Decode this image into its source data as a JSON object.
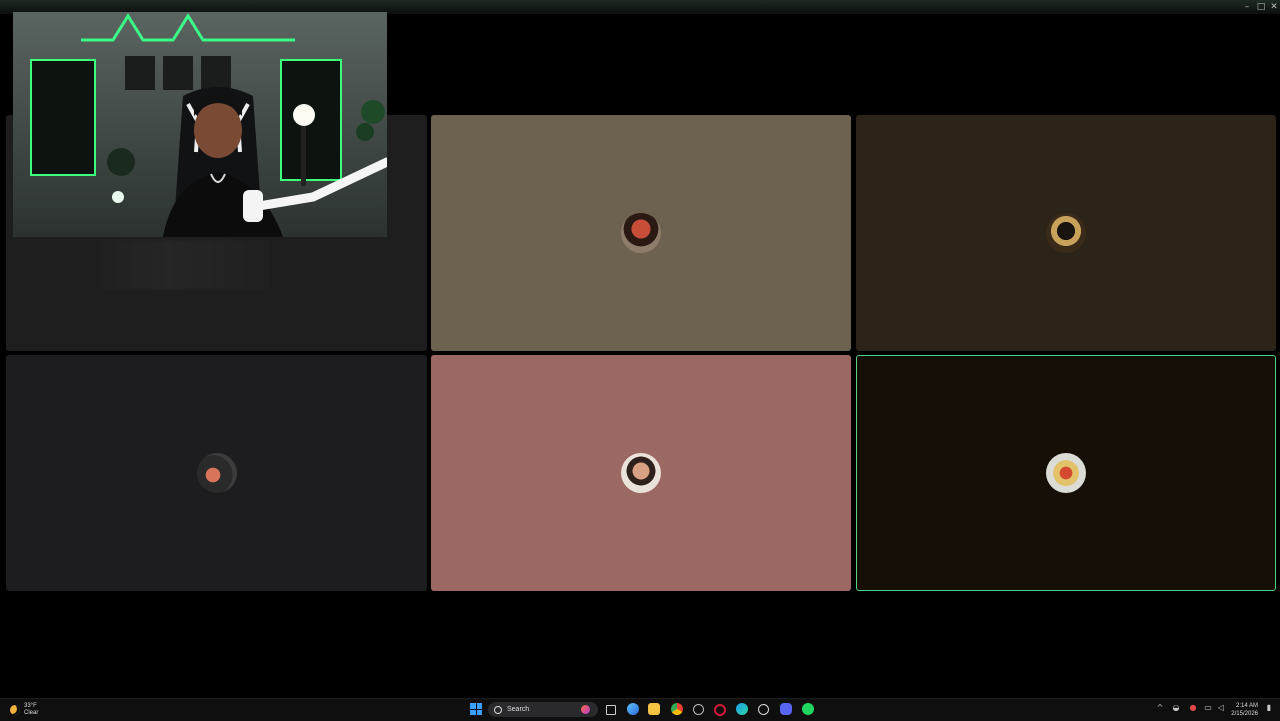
{
  "window": {
    "controls": {
      "minimize": "–",
      "maximize": "□",
      "close": "✕"
    }
  },
  "tiles": [
    {
      "id": "tile-1",
      "bg": "#1e1e1f",
      "avatar": "webcam-stream"
    },
    {
      "id": "tile-2",
      "bg": "#6d6250",
      "avatar": "participant-avatar-2"
    },
    {
      "id": "tile-3",
      "bg": "#2c2418",
      "avatar": "participant-avatar-3"
    },
    {
      "id": "tile-4",
      "bg": "#1d1d1f",
      "avatar": "participant-avatar-4"
    },
    {
      "id": "tile-5",
      "bg": "#9c6863",
      "avatar": "participant-avatar-5"
    },
    {
      "id": "tile-6",
      "bg": "#150f08",
      "avatar": "participant-avatar-6",
      "speaking": true
    }
  ],
  "taskbar": {
    "weather": {
      "temp": "33°F",
      "condition": "Clear",
      "icon": "moon-icon"
    },
    "search": {
      "label": "Search"
    },
    "apps": [
      "windows-start-icon",
      "search-icon",
      "copilot-icon",
      "task-view-icon",
      "edge-icon",
      "file-explorer-icon",
      "chrome-icon",
      "settings-icon",
      "opera-icon",
      "edge-browser-icon",
      "obs-icon",
      "discord-icon",
      "spotify-icon"
    ],
    "tray": [
      "chevron-up-icon",
      "network-icon",
      "microphone-icon",
      "display-icon",
      "volume-icon"
    ],
    "clock": {
      "time": "2:14 AM",
      "date": "2/15/2026"
    }
  },
  "colors": {
    "speaking_border": "#4fd483",
    "accent_green": "#39ff88",
    "taskbar_bg": "#0f0f10"
  }
}
